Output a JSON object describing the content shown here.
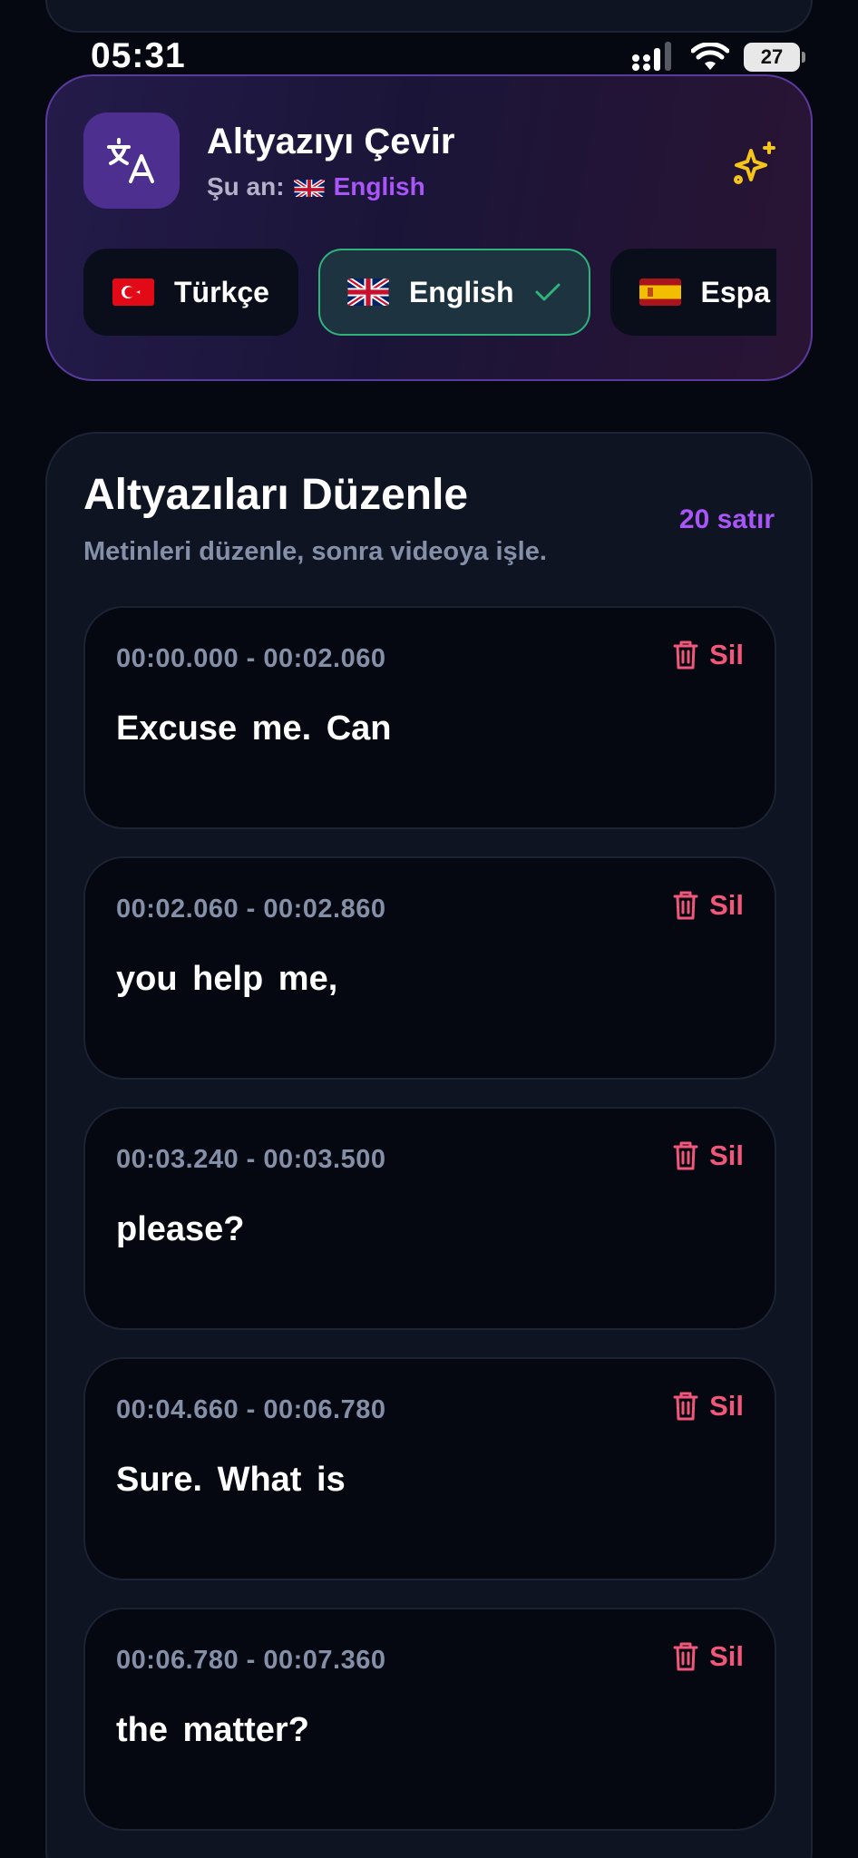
{
  "status_bar": {
    "time": "05:31",
    "battery": "27"
  },
  "translate": {
    "title": "Altyazıyı Çevir",
    "current_label": "Şu an:",
    "current_language": "English",
    "languages": [
      {
        "name": "Türkçe",
        "flag": "tr-flag-icon",
        "selected": false
      },
      {
        "name": "English",
        "flag": "uk-flag-icon",
        "selected": true
      },
      {
        "name": "Espa",
        "flag": "es-flag-icon",
        "selected": false
      }
    ]
  },
  "editor": {
    "title": "Altyazıları Düzenle",
    "subtitle": "Metinleri düzenle, sonra videoya işle.",
    "count": "20 satır",
    "delete_label": "Sil",
    "items": [
      {
        "time": "00:00.000 - 00:02.060",
        "text": "Excuse me. Can"
      },
      {
        "time": "00:02.060 - 00:02.860",
        "text": "you help me,"
      },
      {
        "time": "00:03.240 - 00:03.500",
        "text": "please?"
      },
      {
        "time": "00:04.660 - 00:06.780",
        "text": "Sure. What is"
      },
      {
        "time": "00:06.780 - 00:07.360",
        "text": "the matter?"
      },
      {
        "time": "",
        "text": ""
      }
    ]
  },
  "colors": {
    "accent": "#a955f7",
    "delete": "#f1577a",
    "selected_border": "#2fb37a",
    "sparkle": "#f5c518"
  }
}
